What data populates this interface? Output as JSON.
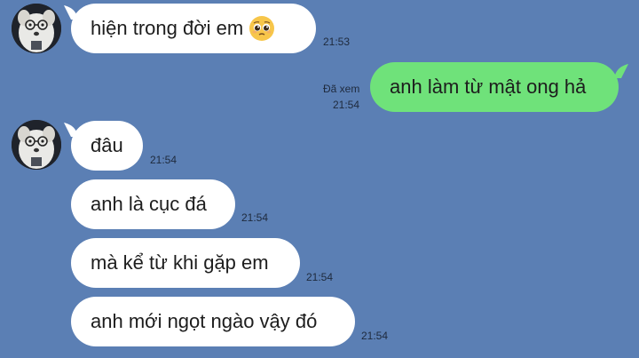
{
  "chat": {
    "messages": [
      {
        "side": "in",
        "text": "hiện trong đời em",
        "time": "21:53",
        "emoji": "pleading-face"
      },
      {
        "side": "out",
        "text": "anh làm từ mật ong hả",
        "status": "Đã xem",
        "time": "21:54"
      },
      {
        "side": "in",
        "text": "đâu",
        "time": "21:54"
      },
      {
        "side": "in",
        "text": "anh là cục đá",
        "time": "21:54"
      },
      {
        "side": "in",
        "text": "mà kể từ khi gặp em",
        "time": "21:54"
      },
      {
        "side": "in",
        "text": "anh mới ngọt ngào vậy đó",
        "time": "21:54"
      }
    ]
  },
  "colors": {
    "background": "#5b7fb4",
    "incoming_bubble": "#ffffff",
    "outgoing_bubble": "#6fe27a"
  }
}
